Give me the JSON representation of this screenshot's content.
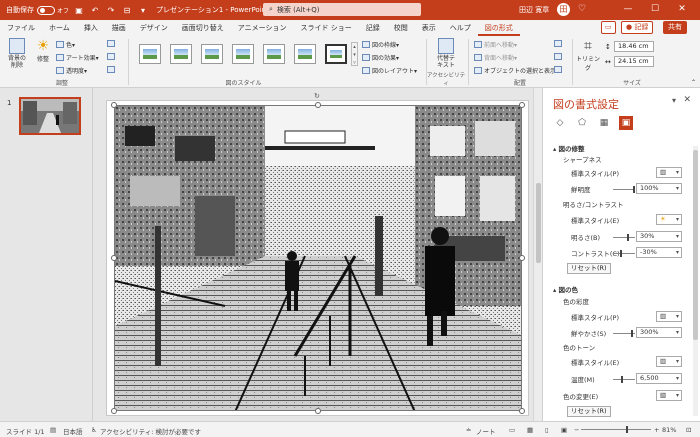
{
  "titlebar": {
    "autosave_label": "自動保存",
    "autosave_state": "オフ",
    "doc_title": "プレゼンテーション1  -  PowerPoint",
    "search_placeholder": "検索 (Alt+Q)",
    "user_name": "田辺 寛章",
    "avatar_initial": "田"
  },
  "tabs": [
    "ファイル",
    "ホーム",
    "挿入",
    "描画",
    "デザイン",
    "画面切り替え",
    "アニメーション",
    "スライド ショー",
    "記録",
    "校閲",
    "表示",
    "ヘルプ",
    "図の形式"
  ],
  "active_tab": "図の形式",
  "tab_buttons": {
    "record": "● 記録",
    "share": "共有"
  },
  "ribbon": {
    "remove_bg": "背景の\n削除",
    "correct": "修整",
    "color": "色▾",
    "art_effects": "アート効果▾",
    "transparency": "透明度▾",
    "adjust_label": "調整",
    "picture_styles_label": "図のスタイル",
    "border": "図の枠線▾",
    "effects": "図の効果▾",
    "layout": "図のレイアウト▾",
    "alt_text": "代替テ\nキスト",
    "accessibility_label": "アクセシビリティ",
    "bring_forward": "前面へ移動▾",
    "send_backward": "背面へ移動▾",
    "selection_pane": "オブジェクトの選択と表示",
    "arrange_label": "配置",
    "crop": "トリミング",
    "height": "18.46 cm",
    "width": "24.15 cm",
    "size_label": "サイズ"
  },
  "thumbnail": {
    "slide_number": "1"
  },
  "pane": {
    "title": "図の書式設定",
    "icons": [
      "fill-line-icon",
      "effects-icon",
      "size-properties-icon",
      "picture-icon"
    ],
    "correction_header": "図の修整",
    "sharpness_header": "シャープネス",
    "preset_label_1": "標準スタイル(P)",
    "sharpness_label": "鮮明度",
    "sharpness_value": "100%",
    "bc_header": "明るさ/コントラスト",
    "preset_label_2": "標準スタイル(E)",
    "brightness_label": "明るさ(B)",
    "brightness_value": "30%",
    "contrast_label": "コントラスト(C)",
    "contrast_value": "-30%",
    "reset_1": "リセット(R)",
    "color_header": "図の色",
    "saturation_header": "色の彩度",
    "preset_label_3": "標準スタイル(P)",
    "saturation_label": "鮮やかさ(S)",
    "saturation_value": "300%",
    "tone_header": "色のトーン",
    "preset_label_4": "標準スタイル(E)",
    "temperature_label": "温度(M)",
    "temperature_value": "6,500",
    "recolor_label": "色の変更(E)",
    "reset_2": "リセット(R)"
  },
  "status": {
    "slide": "スライド 1/1",
    "language": "日本語",
    "accessibility": "アクセシビリティ: 検討が必要です",
    "notes": "ノート",
    "zoom": "81%"
  }
}
